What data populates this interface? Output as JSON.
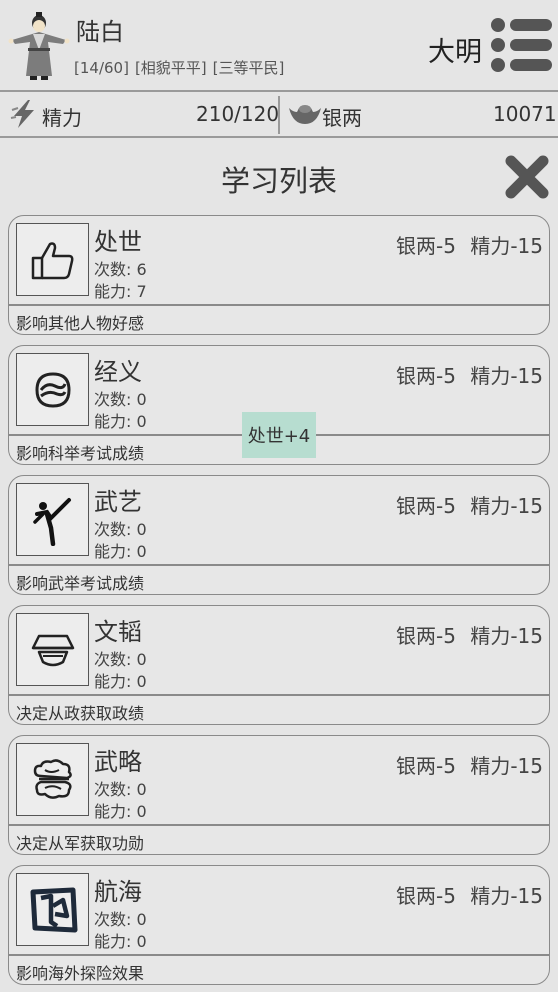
{
  "player": {
    "name": "陆白",
    "tags": [
      "[14/60]",
      "[相貌平平]",
      "[三等平民]"
    ],
    "dynasty": "大明"
  },
  "resources": {
    "energy_label": "精力",
    "energy_value": "210/120",
    "silver_label": "银两",
    "silver_value": "10071"
  },
  "panel": {
    "title": "学习列表"
  },
  "skills": [
    {
      "name": "处世",
      "count": "次数: 6",
      "ability": "能力: 7",
      "cost": "银两-5 精力-15",
      "desc": "影响其他人物好感",
      "icon": "thumbs-up-icon"
    },
    {
      "name": "经义",
      "count": "次数: 0",
      "ability": "能力: 0",
      "cost": "银两-5 精力-15",
      "desc": "影响科举考试成绩",
      "icon": "scroll-swirl-icon"
    },
    {
      "name": "武艺",
      "count": "次数: 0",
      "ability": "能力: 0",
      "cost": "银两-5 精力-15",
      "desc": "影响武举考试成绩",
      "icon": "martial-kick-icon"
    },
    {
      "name": "文韬",
      "count": "次数: 0",
      "ability": "能力: 0",
      "cost": "银两-5 精力-15",
      "desc": "决定从政获取政绩",
      "icon": "scholar-hat-icon"
    },
    {
      "name": "武略",
      "count": "次数: 0",
      "ability": "能力: 0",
      "cost": "银两-5 精力-15",
      "desc": "决定从军获取功勋",
      "icon": "cloud-strategy-icon"
    },
    {
      "name": "航海",
      "count": "次数: 0",
      "ability": "能力: 0",
      "cost": "银两-5 精力-15",
      "desc": "影响海外探险效果",
      "icon": "sea-map-icon"
    }
  ],
  "toast": {
    "text": "处世+4"
  },
  "colors": {
    "background": "#e5e5e5",
    "border": "#8a8a8a",
    "toast_bg": "#b7ddd0"
  }
}
